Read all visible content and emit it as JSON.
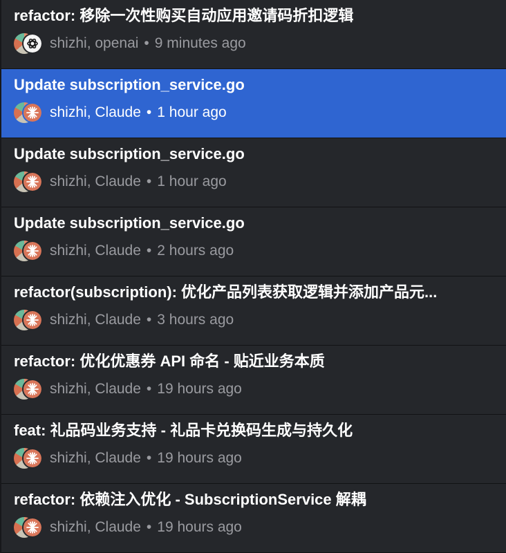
{
  "colors": {
    "background": "#25272b",
    "selected": "#2f65d1",
    "title_text": "#ffffff",
    "meta_text": "#9a9ba0",
    "claude_avatar": "#d9765a",
    "openai_avatar": "#f5f5f5"
  },
  "commits": [
    {
      "title": "refactor: 移除一次性购买自动应用邀请码折扣逻辑",
      "authors": "shizhi, openai",
      "separator": "•",
      "time": "9 minutes ago",
      "agent_icon": "openai-icon",
      "selected": false
    },
    {
      "title": "Update subscription_service.go",
      "authors": "shizhi, Claude",
      "separator": "•",
      "time": "1 hour ago",
      "agent_icon": "claude-icon",
      "selected": true
    },
    {
      "title": "Update subscription_service.go",
      "authors": "shizhi, Claude",
      "separator": "•",
      "time": "1 hour ago",
      "agent_icon": "claude-icon",
      "selected": false
    },
    {
      "title": "Update subscription_service.go",
      "authors": "shizhi, Claude",
      "separator": "•",
      "time": "2 hours ago",
      "agent_icon": "claude-icon",
      "selected": false
    },
    {
      "title": "refactor(subscription): 优化产品列表获取逻辑并添加产品元...",
      "authors": "shizhi, Claude",
      "separator": "•",
      "time": "3 hours ago",
      "agent_icon": "claude-icon",
      "selected": false
    },
    {
      "title": "refactor: 优化优惠券 API 命名 - 贴近业务本质",
      "authors": "shizhi, Claude",
      "separator": "•",
      "time": "19 hours ago",
      "agent_icon": "claude-icon",
      "selected": false
    },
    {
      "title": "feat: 礼品码业务支持 - 礼品卡兑换码生成与持久化",
      "authors": "shizhi, Claude",
      "separator": "•",
      "time": "19 hours ago",
      "agent_icon": "claude-icon",
      "selected": false
    },
    {
      "title": "refactor: 依赖注入优化 - SubscriptionService 解耦",
      "authors": "shizhi, Claude",
      "separator": "•",
      "time": "19 hours ago",
      "agent_icon": "claude-icon",
      "selected": false
    }
  ]
}
